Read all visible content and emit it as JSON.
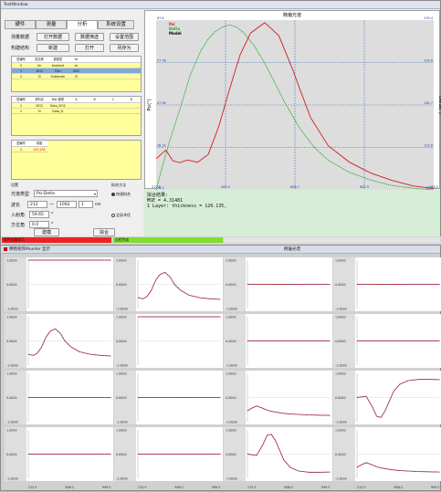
{
  "main": {
    "title": "TestWindow",
    "tabs": [
      "硬件",
      "测量",
      "分析",
      "系统设置"
    ],
    "active_tab": 2,
    "row1": {
      "label": "测量数据",
      "b1": "打开数据",
      "b2": "数据筛选",
      "b3": "设置范围"
    },
    "row2": {
      "label": "构建结构",
      "b1": "新建",
      "b2": "打开",
      "b3": "另存为"
    },
    "grid1": {
      "headers": [
        "层编号",
        "层名称",
        "模型层",
        "dc",
        "",
        "",
        ""
      ],
      "rows": [
        [
          "0",
          "Air",
          "Ambient",
          "dc",
          "",
          "",
          ""
        ],
        [
          "1",
          "SiO2",
          "Film",
          "SiO2",
          "",
          "",
          ""
        ],
        [
          "2",
          "Si",
          "Substrate",
          "Si",
          "",
          "",
          ""
        ]
      ],
      "selected": 1
    },
    "grid2": {
      "headers": [
        "层编号",
        "材料名",
        "Mat 模型",
        "A",
        "B",
        "C",
        "D"
      ],
      "rows": [
        [
          "1",
          "SiO2",
          "Data_SiO2",
          "",
          "",
          "",
          ""
        ],
        [
          "2",
          "Si",
          "Data_Si",
          "",
          "",
          "",
          ""
        ]
      ]
    },
    "grid3": {
      "headers": [
        "层编号",
        "厚度"
      ],
      "rows": [
        [
          "1",
          "120.135"
        ]
      ]
    },
    "settings": {
      "section": "设置",
      "curve_label": "光谱类型",
      "curve_value": "Psi-Delta",
      "wl_label": "波长",
      "wl_from": "212",
      "wl_to": "1002",
      "wl_step": "1",
      "wl_unit": "nm",
      "angle_label": "入射角",
      "angle_value": "59.65",
      "angle_unit": "°",
      "azi_label": "方位角",
      "azi_value": "0.0",
      "azi_unit": "°",
      "algo_label": "拟合方法",
      "radio1": "快速拟合",
      "radio2": "全局寻优",
      "b_create": "建模",
      "b_fit": "拟合"
    },
    "result": {
      "title": "拟合结果:",
      "mse": "MSE = 4.31481",
      "layer": "1 Layer: thickness = 120.135,"
    },
    "status": {
      "s1": "软件连接成功",
      "s2": "自检完成"
    }
  },
  "big_chart": {
    "title": "椭偏光谱",
    "ylabel_left": "Psi(°)",
    "ylabel_right": "Delta(°)",
    "xlabel": "波长(nm)"
  },
  "mueller": {
    "title": "穆勒矩阵Mueller 显示",
    "header": "椭偏光谱"
  },
  "chart_data": [
    {
      "type": "line",
      "title": "椭偏光谱",
      "xlabel": "波长(nm)",
      "ylabel": "Psi(°)",
      "y2label": "Delta(°)",
      "xlim": [
        212.5,
        998.5
      ],
      "ylim": [
        28.3,
        67.6
      ],
      "y2lim": [
        84.0,
        239.4
      ],
      "x_ticks": [
        "212.5",
        "409.5",
        "606.7",
        "802.9",
        "998.5"
      ],
      "y_ticks": [
        "28.3",
        "38.14",
        "47.96",
        "57.78",
        "67.6"
      ],
      "y2_ticks": [
        "84.0",
        "122.8",
        "161.7",
        "200.6",
        "239.4"
      ],
      "legend": [
        "Psi",
        "Delta",
        "Model"
      ],
      "colors": {
        "Psi": "#d21e1e",
        "Delta": "#1aa81a",
        "Model": "#000000"
      },
      "series": [
        {
          "name": "Psi",
          "x": [
            212.5,
            240,
            260,
            280,
            300,
            330,
            360,
            390,
            420,
            450,
            480,
            520,
            560,
            600,
            620,
            650,
            700,
            760,
            820,
            880,
            940,
            998.5
          ],
          "y": [
            35.5,
            37.5,
            35.0,
            34.6,
            35.2,
            34.7,
            36.5,
            43.0,
            51.5,
            59.5,
            64.6,
            67.0,
            64.0,
            56.0,
            51.5,
            45.0,
            38.5,
            34.7,
            32.2,
            30.5,
            29.2,
            28.6
          ]
        },
        {
          "name": "Delta",
          "x": [
            212.5,
            230,
            250,
            280,
            310,
            340,
            360,
            380,
            400,
            420,
            440,
            460,
            490,
            520,
            550,
            580,
            620,
            660,
            700,
            760,
            820,
            880,
            940,
            998.5
          ],
          "y": [
            84.0,
            105.0,
            128.0,
            158.0,
            190.0,
            212.0,
            222.0,
            229.0,
            233.0,
            235.0,
            233.0,
            228.0,
            216.0,
            200.0,
            181.0,
            162.0,
            140.0,
            123.0,
            111.0,
            100.0,
            93.0,
            88.0,
            85.5,
            84.0
          ]
        }
      ]
    },
    {
      "type": "line",
      "title": "穆勒矩阵Mueller 显示",
      "grid": [
        4,
        4
      ],
      "xlim": [
        212.5,
        998.5
      ],
      "x_ticks": [
        "212.5",
        "606.2",
        "999.5"
      ],
      "y_ticks": [
        "1.0000",
        "0.5000",
        "0.0000",
        "-0.5000",
        "-1.0000"
      ],
      "ylim": [
        -1,
        1
      ],
      "colors": {
        "measured": "#cc2222",
        "model": "#3a55aa"
      },
      "series": [
        {
          "name": "m11",
          "x": [
            212,
            999
          ],
          "y": [
            1.0,
            1.0
          ]
        },
        {
          "name": "m12",
          "x": [
            212,
            260,
            300,
            340,
            380,
            420,
            470,
            520,
            560,
            620,
            700,
            800,
            900,
            999
          ],
          "y": [
            -0.55,
            -0.6,
            -0.5,
            -0.25,
            0.15,
            0.4,
            0.5,
            0.3,
            0.0,
            -0.25,
            -0.45,
            -0.55,
            -0.6,
            -0.62
          ]
        },
        {
          "name": "m13",
          "x": [
            212,
            999
          ],
          "y": [
            0.0,
            0.0
          ]
        },
        {
          "name": "m14",
          "x": [
            212,
            999
          ],
          "y": [
            0.0,
            0.0
          ]
        },
        {
          "name": "m21",
          "x": [
            212,
            260,
            300,
            340,
            380,
            420,
            470,
            520,
            560,
            620,
            700,
            800,
            900,
            999
          ],
          "y": [
            -0.55,
            -0.6,
            -0.5,
            -0.25,
            0.15,
            0.4,
            0.5,
            0.3,
            0.0,
            -0.25,
            -0.45,
            -0.55,
            -0.6,
            -0.62
          ]
        },
        {
          "name": "m22",
          "x": [
            212,
            999
          ],
          "y": [
            1.0,
            1.0
          ]
        },
        {
          "name": "m23",
          "x": [
            212,
            999
          ],
          "y": [
            0.0,
            0.0
          ]
        },
        {
          "name": "m24",
          "x": [
            212,
            999
          ],
          "y": [
            0.0,
            0.0
          ]
        },
        {
          "name": "m31",
          "x": [
            212,
            999
          ],
          "y": [
            0.0,
            0.0
          ]
        },
        {
          "name": "m32",
          "x": [
            212,
            999
          ],
          "y": [
            0.0,
            0.0
          ]
        },
        {
          "name": "m33",
          "x": [
            212,
            250,
            300,
            360,
            420,
            480,
            550,
            620,
            700,
            800,
            900,
            999
          ],
          "y": [
            -0.55,
            -0.45,
            -0.35,
            -0.45,
            -0.55,
            -0.6,
            -0.65,
            -0.68,
            -0.7,
            -0.72,
            -0.73,
            -0.74
          ]
        },
        {
          "name": "m34",
          "x": [
            212,
            300,
            360,
            400,
            440,
            480,
            520,
            560,
            620,
            700,
            800,
            900,
            999
          ],
          "y": [
            0.0,
            0.05,
            -0.4,
            -0.78,
            -0.82,
            -0.55,
            -0.15,
            0.25,
            0.55,
            0.7,
            0.75,
            0.75,
            0.74
          ]
        },
        {
          "name": "m41",
          "x": [
            212,
            999
          ],
          "y": [
            0.0,
            0.0
          ]
        },
        {
          "name": "m42",
          "x": [
            212,
            999
          ],
          "y": [
            0.0,
            0.0
          ]
        },
        {
          "name": "m43",
          "x": [
            212,
            300,
            360,
            400,
            440,
            480,
            520,
            560,
            620,
            700,
            800,
            900,
            999
          ],
          "y": [
            0.0,
            -0.05,
            0.4,
            0.78,
            0.82,
            0.55,
            0.15,
            -0.25,
            -0.55,
            -0.7,
            -0.75,
            -0.75,
            -0.74
          ]
        },
        {
          "name": "m44",
          "x": [
            212,
            250,
            300,
            360,
            420,
            480,
            550,
            620,
            700,
            800,
            900,
            999
          ],
          "y": [
            -0.55,
            -0.45,
            -0.35,
            -0.45,
            -0.55,
            -0.6,
            -0.65,
            -0.68,
            -0.7,
            -0.72,
            -0.73,
            -0.74
          ]
        }
      ]
    }
  ]
}
